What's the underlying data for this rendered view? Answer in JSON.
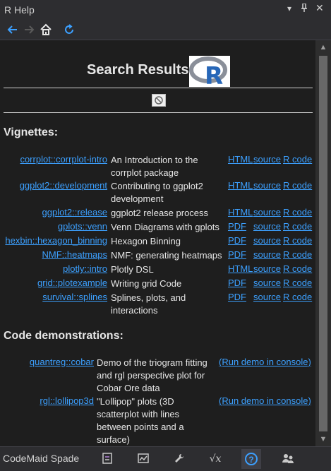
{
  "window": {
    "title": "R Help"
  },
  "header": {
    "title": "Search Results"
  },
  "sections": {
    "vignettes": "Vignettes:",
    "demos": "Code demonstrations:"
  },
  "vignettes": [
    {
      "pkg": "corrplot::corrplot-intro",
      "desc": "An Introduction to the corrplot package",
      "l1": "HTML",
      "l2": "source",
      "l3": "R code"
    },
    {
      "pkg": "ggplot2::development",
      "desc": "Contributing to ggplot2 development",
      "l1": "HTML",
      "l2": "source",
      "l3": "R code"
    },
    {
      "pkg": "ggplot2::release",
      "desc": "ggplot2 release process",
      "l1": "HTML",
      "l2": "source",
      "l3": "R code"
    },
    {
      "pkg": "gplots::venn",
      "desc": "Venn Diagrams with gplots",
      "l1": "PDF",
      "l2": "source",
      "l3": "R code"
    },
    {
      "pkg": "hexbin::hexagon_binning",
      "desc": "Hexagon Binning",
      "l1": "PDF",
      "l2": "source",
      "l3": "R code"
    },
    {
      "pkg": "NMF::heatmaps",
      "desc": "NMF: generating heatmaps",
      "l1": "PDF",
      "l2": "source",
      "l3": "R code"
    },
    {
      "pkg": "plotly::intro",
      "desc": "Plotly DSL",
      "l1": "HTML",
      "l2": "source",
      "l3": "R code"
    },
    {
      "pkg": "grid::plotexample",
      "desc": "Writing grid Code",
      "l1": "PDF",
      "l2": "source",
      "l3": "R code"
    },
    {
      "pkg": "survival::splines",
      "desc": "Splines, plots, and interactions",
      "l1": "PDF",
      "l2": "source",
      "l3": "R code"
    }
  ],
  "demos": [
    {
      "pkg": "quantreg::cobar",
      "desc": "Demo of the triogram fitting and rgl perspective plot for Cobar Ore data",
      "link": "(Run demo in console)"
    },
    {
      "pkg": "rgl::lollipop3d",
      "desc": "\"Lollipop\" plots (3D scatterplot with lines between points and a surface)",
      "link": "(Run demo in console)"
    }
  ],
  "bottom": {
    "label": "CodeMaid Spade"
  },
  "colors": {
    "link": "#3ca0ff",
    "background": "#1e1e1e",
    "chrome": "#2d2d30"
  }
}
